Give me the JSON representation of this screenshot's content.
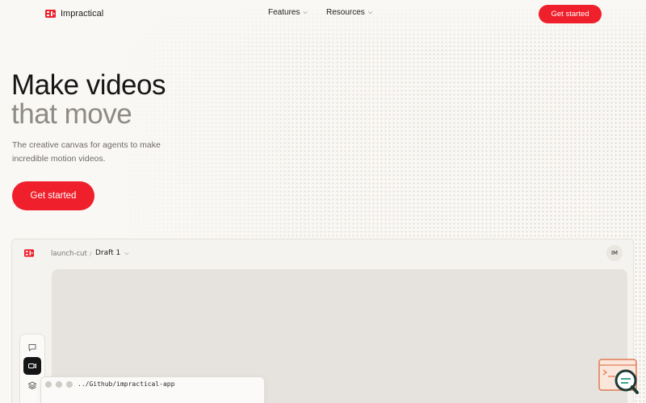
{
  "nav": {
    "brand": "Impractical",
    "items": [
      {
        "label": "Features"
      },
      {
        "label": "Resources"
      }
    ],
    "cta": "Get started"
  },
  "hero": {
    "title_line1": "Make videos",
    "title_line2": "that move",
    "subtitle": "The creative canvas for agents to make incredible motion videos.",
    "cta": "Get started"
  },
  "app": {
    "project": "launch-cut",
    "separator": "/",
    "draft": "Draft 1",
    "avatar": "IM",
    "tools": [
      {
        "icon": "chat-icon"
      },
      {
        "icon": "video-icon",
        "active": true
      },
      {
        "icon": "layers-icon"
      }
    ],
    "terminal_path": "../Github/impractical-app"
  },
  "colors": {
    "accent": "#ef1f2b",
    "background": "#faf8f5",
    "canvas": "#e6e2dd",
    "muted_text": "#8e8a85"
  }
}
